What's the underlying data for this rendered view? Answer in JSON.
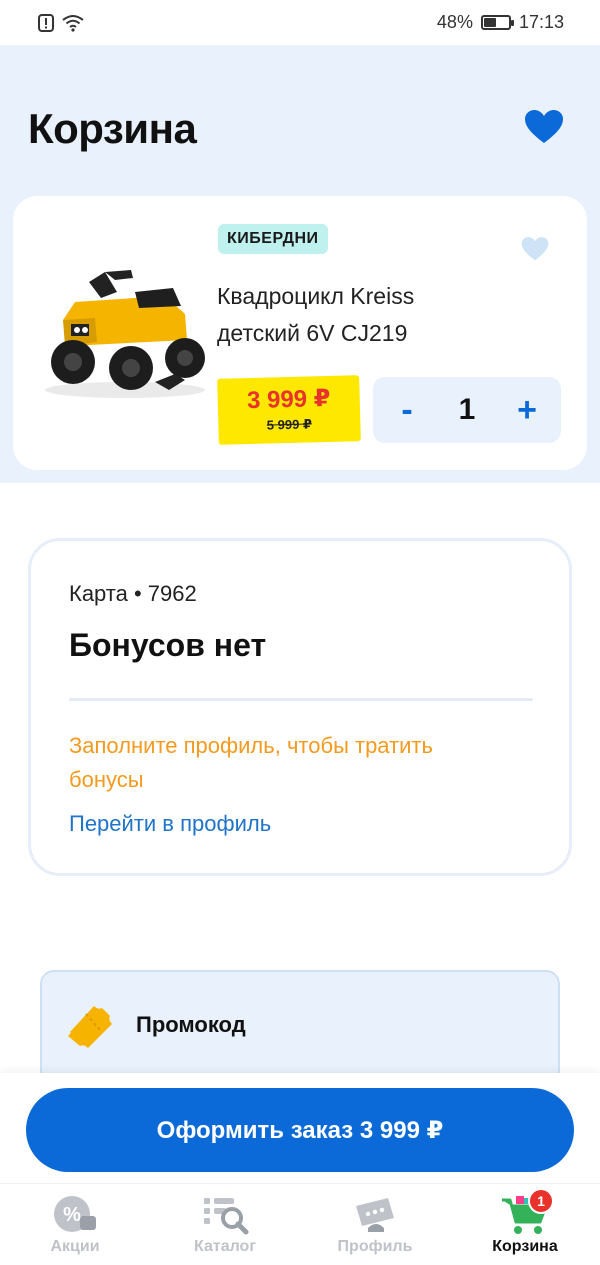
{
  "status_bar": {
    "battery": "48%",
    "time": "17:13",
    "battery_level": 0.48
  },
  "header": {
    "title": "Корзина"
  },
  "product": {
    "brand": "КИБЕРДНИ",
    "title": "Квадроцикл Kreiss детский 6V CJ219",
    "price_now": "3 999 ₽",
    "price_old": "5 999 ₽",
    "quantity": "1",
    "decrement": "-",
    "increment": "+"
  },
  "bonus": {
    "card_label": "Карта • 7962",
    "title": "Бонусов нет",
    "hint": "Заполните профиль, чтобы тратить бонусы",
    "link": "Перейти в профиль"
  },
  "promo": {
    "label": "Промокод"
  },
  "checkout": {
    "label": "Оформить заказ 3 999 ₽"
  },
  "nav": {
    "items": [
      {
        "label": "Акции",
        "icon": "percent-tag-icon"
      },
      {
        "label": "Каталог",
        "icon": "catalog-search-icon"
      },
      {
        "label": "Профиль",
        "icon": "profile-card-icon"
      },
      {
        "label": "Корзина",
        "icon": "cart-icon",
        "badge": "1"
      }
    ]
  },
  "colors": {
    "accent": "#0b6ad8",
    "price_tag": "#ffe800",
    "price_red": "#e8322b",
    "hint_orange": "#f39a1f",
    "link_blue": "#1f73c9",
    "header_bg": "#e8f1fc",
    "badge_teal": "#bff1ef"
  }
}
